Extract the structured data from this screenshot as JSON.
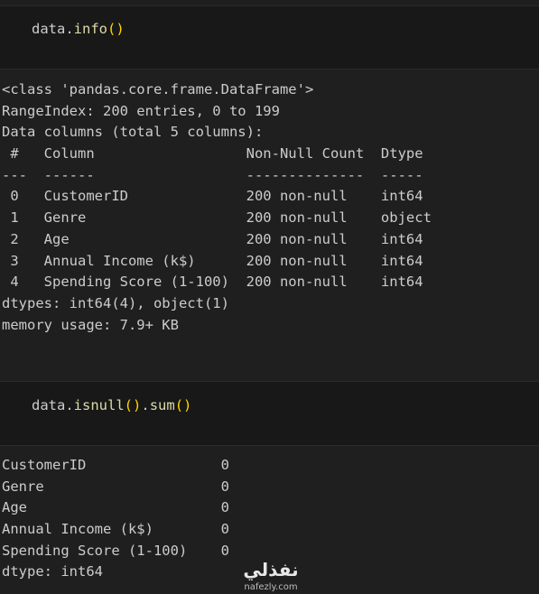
{
  "cells": [
    {
      "code": {
        "object": "data",
        "dot1": ".",
        "method1": "info",
        "paren_open1": "(",
        "paren_close1": ")"
      },
      "output_lines": [
        "<class 'pandas.core.frame.DataFrame'>",
        "RangeIndex: 200 entries, 0 to 199",
        "Data columns (total 5 columns):",
        " #   Column                  Non-Null Count  Dtype ",
        "---  ------                  --------------  ----- ",
        " 0   CustomerID              200 non-null    int64 ",
        " 1   Genre                   200 non-null    object",
        " 2   Age                     200 non-null    int64 ",
        " 3   Annual Income (k$)      200 non-null    int64 ",
        " 4   Spending Score (1-100)  200 non-null    int64 ",
        "dtypes: int64(4), object(1)",
        "memory usage: 7.9+ KB"
      ]
    },
    {
      "code": {
        "object": "data",
        "dot1": ".",
        "method1": "isnull",
        "paren_open1": "(",
        "paren_close1": ")",
        "dot2": ".",
        "method2": "sum",
        "paren_open2": "(",
        "paren_close2": ")"
      },
      "output_lines": [
        "CustomerID                0",
        "Genre                     0",
        "Age                       0",
        "Annual Income (k$)        0",
        "Spending Score (1-100)    0",
        "dtype: int64"
      ]
    }
  ],
  "watermark": {
    "arabic": "نفذلي",
    "latin": "nafezly.com"
  }
}
